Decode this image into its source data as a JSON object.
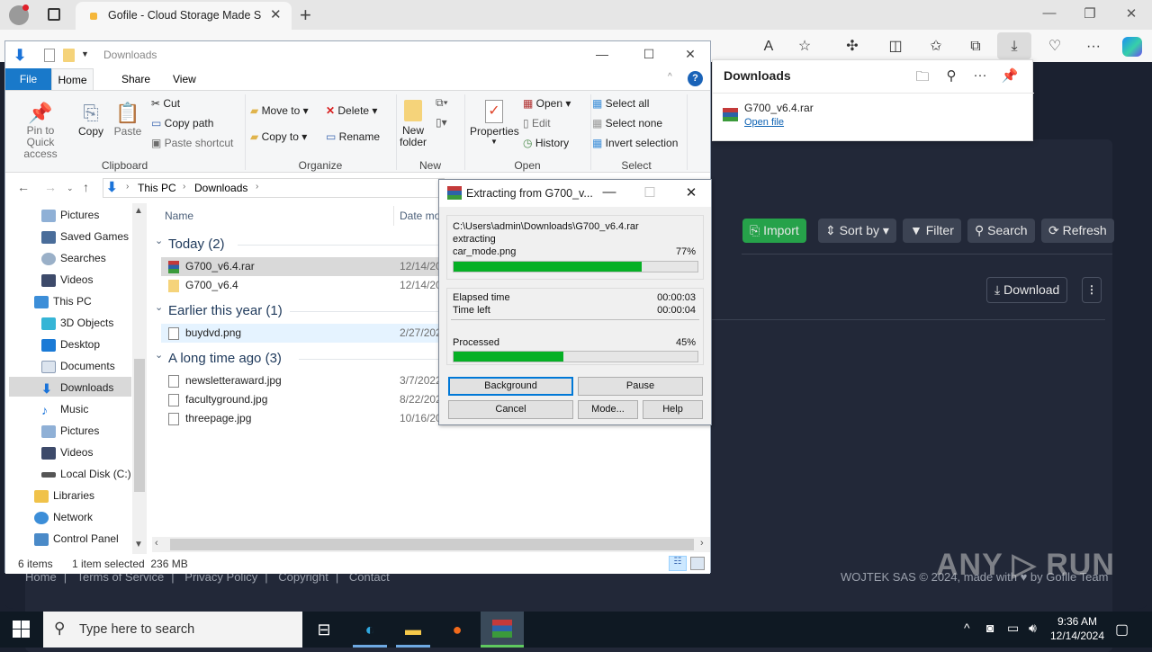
{
  "browser": {
    "tab_title": "Gofile - Cloud Storage Made Simple",
    "new_tab_icon": "plus-icon",
    "toolbar_icons": [
      "read-aloud-icon",
      "favorite-star-icon",
      "extensions-icon",
      "split-screen-icon",
      "favorites-icon",
      "collections-icon",
      "download-icon",
      "browser-essentials-icon",
      "more-icon",
      "copilot-icon"
    ]
  },
  "downloads_panel": {
    "title": "Downloads",
    "file_name": "G700_v6.4.rar",
    "open_link": "Open file"
  },
  "gofile": {
    "buttons": {
      "import": "Import",
      "sort_by": "Sort by",
      "filter": "Filter",
      "search": "Search",
      "refresh": "Refresh",
      "download": "Download"
    },
    "footer_links": [
      "Home",
      "Terms of Service",
      "Privacy Policy",
      "Copyright",
      "Contact"
    ],
    "footer_copy": "WOJTEK SAS © 2024, made with ♥ by Gofile Team",
    "watermark": "ANY ▷ RUN"
  },
  "explorer": {
    "title": "Downloads",
    "ribbon_tabs": [
      "File",
      "Home",
      "Share",
      "View"
    ],
    "clipboard": {
      "pin": "Pin to Quick access",
      "copy": "Copy",
      "paste": "Paste",
      "cut": "Cut",
      "copy_path": "Copy path",
      "paste_shortcut": "Paste shortcut",
      "label": "Clipboard"
    },
    "organize": {
      "move_to": "Move to",
      "copy_to": "Copy to",
      "delete": "Delete",
      "rename": "Rename",
      "label": "Organize"
    },
    "new": {
      "new_folder": "New folder",
      "label": "New"
    },
    "open": {
      "properties": "Properties",
      "open": "Open",
      "edit": "Edit",
      "history": "History",
      "label": "Open"
    },
    "select": {
      "select_all": "Select all",
      "select_none": "Select none",
      "invert": "Invert selection",
      "label": "Select"
    },
    "breadcrumb": [
      "This PC",
      "Downloads"
    ],
    "sidebar": [
      "Pictures",
      "Saved Games",
      "Searches",
      "Videos",
      "This PC",
      "3D Objects",
      "Desktop",
      "Documents",
      "Downloads",
      "Music",
      "Pictures",
      "Videos",
      "Local Disk (C:)",
      "Libraries",
      "Network",
      "Control Panel"
    ],
    "columns": {
      "name": "Name",
      "date": "Date mo"
    },
    "groups": [
      {
        "label": "Today (2)",
        "files": [
          {
            "name": "G700_v6.4.rar",
            "date": "12/14/20",
            "selected": true
          },
          {
            "name": "G700_v6.4",
            "date": "12/14/20"
          }
        ]
      },
      {
        "label": "Earlier this year (1)",
        "files": [
          {
            "name": "buydvd.png",
            "date": "2/27/202",
            "hover": true
          }
        ]
      },
      {
        "label": "A long time ago (3)",
        "files": [
          {
            "name": "newsletteraward.jpg",
            "date": "3/7/2022"
          },
          {
            "name": "facultyground.jpg",
            "date": "8/22/202"
          },
          {
            "name": "threepage.jpg",
            "date": "10/16/20"
          }
        ]
      }
    ],
    "status": {
      "items": "6 items",
      "selected": "1 item selected  236 MB"
    }
  },
  "winrar": {
    "title": "Extracting from G700_v...",
    "archive_path": "C:\\Users\\admin\\Downloads\\G700_v6.4.rar",
    "action": "extracting",
    "current_file": "car_mode.png",
    "file_progress_label": "77%",
    "file_progress": 0.77,
    "elapsed_label": "Elapsed time",
    "elapsed": "00:00:03",
    "time_left_label": "Time left",
    "time_left": "00:00:04",
    "processed_label": "Processed",
    "processed_pct_label": "45%",
    "processed": 0.45,
    "buttons": {
      "background": "Background",
      "pause": "Pause",
      "cancel": "Cancel",
      "mode": "Mode...",
      "help": "Help"
    }
  },
  "taskbar": {
    "search_placeholder": "Type here to search",
    "time": "9:36 AM",
    "date": "12/14/2024"
  }
}
